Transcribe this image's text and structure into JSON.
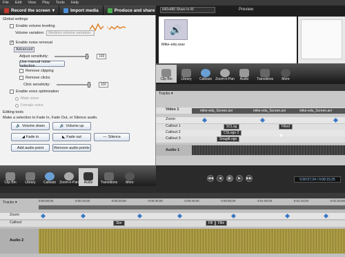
{
  "menu": [
    "File",
    "Edit",
    "View",
    "Play",
    "Tools",
    "Help"
  ],
  "toolbar": {
    "record": "Record the screen",
    "import": "Import media",
    "produce": "Produce and share",
    "preview_title": "Preview",
    "preset": "640x480 Share to W"
  },
  "left": {
    "global_settings": "Global settings",
    "volume_leveling": "Enable volume leveling",
    "volume_variation_label": "Volume variation:",
    "volume_variation_value": "Medium volume variation",
    "noise_removal": "Enable noise removal",
    "advanced": "Advanced",
    "adjust_sensitivity": "Adjust sensitivity:",
    "adjust_sensitivity_value": "100",
    "manual_noise": "Use manual noise selection",
    "remove_clipping": "Remove clipping",
    "remove_clicks": "Remove clicks",
    "click_sensitivity": "Click sensitivity:",
    "click_sensitivity_value": "100",
    "voice_opt": "Enable voice optimization",
    "male": "Male voice",
    "female": "Female voice",
    "editing_tools": "Editing tools",
    "instructions": "Make a selection to Fade In, Fade Out, or Silence audio.",
    "volume_down": "Volume down",
    "volume_up": "Volume up",
    "fade_in": "Fade in",
    "fade_out": "Fade out",
    "silence": "Silence",
    "add_audio_point": "Add audio point",
    "remove_audio_points": "Remove audio points"
  },
  "clipbin": {
    "file": "Mike-edu.wav"
  },
  "tabs": [
    "Clip Bin",
    "Library",
    "Callouts",
    "Zoom-n-Pan",
    "Audio",
    "Transitions",
    "More"
  ],
  "timeline_top": {
    "tracks": "Tracks",
    "rows": [
      "Video 1",
      "Zoom",
      "Callout 1",
      "Callout 2",
      "Callout 3",
      "Audio 1"
    ],
    "video_clips": [
      "mike-edu_Screen.avi",
      "mike-edu_Screen.avi",
      "mike-edu_Screen.avi"
    ],
    "callouts": [
      "SCLog",
      "Filled",
      "CSLogo 2",
      "SnagitLogo"
    ]
  },
  "player": {
    "time": "0:00:57;24 / 0:09:15;25"
  },
  "timeline_bottom": {
    "tracks": "Tracks",
    "rows": [
      "Zoom",
      "Callout",
      "Audio 2"
    ],
    "callouts": [
      "Ske",
      "Fill",
      "Fille"
    ],
    "ticks": [
      "0:00:00;00",
      "0:00:10;00",
      "0:00:20;00",
      "0:00:30;00",
      "0:00:40;00",
      "0:00:50;00",
      "0:01:00;00",
      "0:01:10;00",
      "0:01:20;00"
    ]
  }
}
